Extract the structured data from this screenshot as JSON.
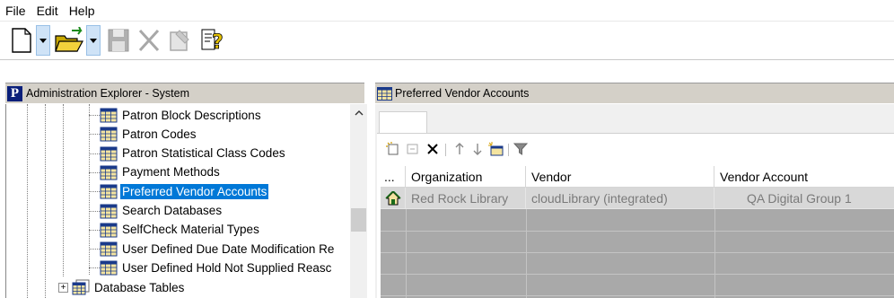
{
  "menu": [
    "File",
    "Edit",
    "Help"
  ],
  "toolbar": {
    "icons": [
      "new-document-icon",
      "dropdown-arrow-icon",
      "open-folder-icon",
      "dropdown-arrow-icon",
      "save-icon",
      "delete-icon",
      "properties-icon",
      "help-icon"
    ]
  },
  "left_panel": {
    "title": "Administration Explorer - System",
    "items": [
      {
        "label": "Patron Block Descriptions",
        "selected": false
      },
      {
        "label": "Patron Codes",
        "selected": false
      },
      {
        "label": "Patron Statistical Class Codes",
        "selected": false
      },
      {
        "label": "Payment Methods",
        "selected": false
      },
      {
        "label": "Preferred Vendor Accounts",
        "selected": true
      },
      {
        "label": "Search Databases",
        "selected": false
      },
      {
        "label": "SelfCheck Material Types",
        "selected": false
      },
      {
        "label": "User Defined Due Date Modification Re",
        "selected": false
      },
      {
        "label": "User Defined Hold Not Supplied Reasc",
        "selected": false
      }
    ],
    "parent_node": {
      "label": "Database Tables",
      "expander": "+"
    }
  },
  "right_panel": {
    "title": "Preferred Vendor Accounts",
    "columns": [
      "...",
      "Organization",
      "Vendor",
      "Vendor Account"
    ],
    "rows": [
      {
        "organization": "Red Rock Library",
        "vendor": "cloudLibrary (integrated)",
        "vendor_account": "QA Digital Group 1"
      }
    ]
  },
  "colors": {
    "selection": "#0078d7",
    "header_bg": "#d4d0c8",
    "grid_bg": "#a9a9a9",
    "row_bg": "#d8d8d8"
  }
}
